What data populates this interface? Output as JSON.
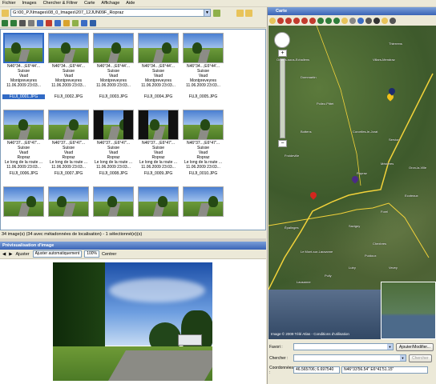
{
  "menu": [
    "Fichier",
    "Images",
    "Chercher & Filtrer",
    "Carte",
    "Affichage",
    "Aide"
  ],
  "left": {
    "path": "G:\\00_PJ\\Images\\08_0_Images\\207_12JUN09F_Ropraz",
    "thumbnails": [
      {
        "coords": "N46°34...;E6°44'...",
        "country": "Suisse",
        "region": "Vaud",
        "place": "Montpreveyres",
        "date": "11.06.2009 23:03...",
        "file": "FUJI_0001.JPG",
        "selected": true
      },
      {
        "coords": "N46°34...;E6°44'...",
        "country": "Suisse",
        "region": "Vaud",
        "place": "Montpreveyres",
        "date": "11.06.2009 23:03...",
        "file": "FUJI_0002.JPG"
      },
      {
        "coords": "N46°34...;E6°44'...",
        "country": "Suisse",
        "region": "Vaud",
        "place": "Montpreveyres",
        "date": "11.06.2009 23:03...",
        "file": "FUJI_0003.JPG"
      },
      {
        "coords": "N46°34...;E6°44'...",
        "country": "Suisse",
        "region": "Vaud",
        "place": "Montpreveyres",
        "date": "11.06.2009 23:03...",
        "file": "FUJI_0004.JPG"
      },
      {
        "coords": "N46°34...;E6°44'...",
        "country": "Suisse",
        "region": "Vaud",
        "place": "Montpreveyres",
        "date": "11.06.2009 23:03...",
        "file": "FUJI_0005.JPG"
      },
      {
        "coords": "N46°37...;E6°47'...",
        "country": "Suisse",
        "region": "Vaud",
        "place": "Ropraz",
        "date": "Le long de la route ...",
        "date2": "11.06.2009 23:03...",
        "file": "FUJI_0006.JPG"
      },
      {
        "coords": "N46°37...;E6°47'...",
        "country": "Suisse",
        "region": "Vaud",
        "place": "Ropraz",
        "date": "Le long de la route ...",
        "date2": "11.06.2009 23:03...",
        "file": "FUJI_0007.JPG"
      },
      {
        "coords": "N46°37...;E6°47'...",
        "country": "Suisse",
        "region": "Vaud",
        "place": "Ropraz",
        "date": "Le long de la route ...",
        "date2": "11.06.2009 23:03...",
        "file": "FUJI_0008.JPG"
      },
      {
        "coords": "N46°37...;E6°47'...",
        "country": "Suisse",
        "region": "Vaud",
        "place": "Ropraz",
        "date": "Le long de la route ...",
        "date2": "11.06.2009 23:03...",
        "file": "FUJI_0009.JPG"
      },
      {
        "coords": "N46°37...;E6°47'...",
        "country": "Suisse",
        "region": "Vaud",
        "place": "Ropraz",
        "date": "Le long de la route ...",
        "date2": "11.06.2009 23:03...",
        "file": "FUJI_0010.JPG"
      }
    ],
    "status": "34 image(s) (34 avec métadonnées de localisation) - 1 sélectionné(e)(s)",
    "preview_title": "Prévisualisation d'image",
    "preview_toolbar": {
      "adjust_label": "Ajuster",
      "adjust_mode": "Ajuster automatiquement",
      "zoom": "100%",
      "center_label": "Centrer"
    }
  },
  "right": {
    "title": "Carte",
    "copyright": "Image © 2009 Télé Atlas - Conditions d'utilisation",
    "towns": [
      "Oulens-sous-Echallens",
      "Dommartin",
      "Villars-Mendraz",
      "Thierrens",
      "Poliez-Pittet",
      "Bottens",
      "Froideville",
      "Corcelles-le-Jorat",
      "Ropraz",
      "Mézières",
      "Servion",
      "Forel",
      "Savigny",
      "Épalinges",
      "Le Mont-sur-Lausanne",
      "Lausanne",
      "Pully",
      "Lutry",
      "Vevey",
      "Chexbres",
      "Puidoux",
      "Ecoteaux",
      "Oron-la-Ville"
    ],
    "favoris_label": "Favori :",
    "favoris_value": "",
    "add_favorite_btn": "Ajouter/Modifier...",
    "chercher_label": "Chercher :",
    "chercher_value": "",
    "chercher_btn": "Chercher",
    "coords_label": "Coordonnées :",
    "coords_decimal": "46.565706; 6.697540",
    "coords_dms": "N46°33'56.54\" E6°41'51.15\""
  }
}
